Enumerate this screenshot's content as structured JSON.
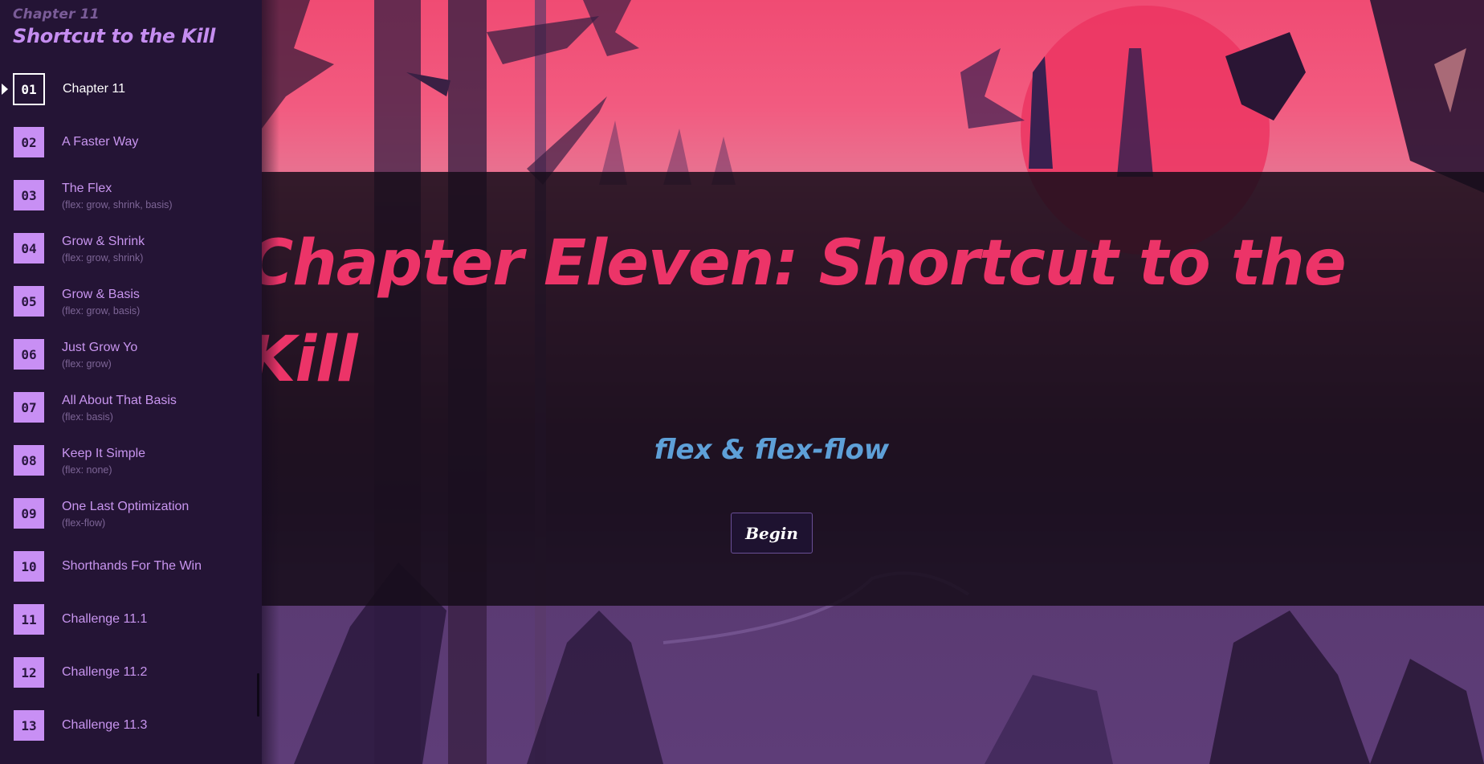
{
  "sidebar": {
    "chapter_kicker": "Chapter 11",
    "chapter_title": "Shortcut to the Kill",
    "active_index": 0,
    "levels": [
      {
        "num": "01",
        "title": "Chapter 11",
        "sub": ""
      },
      {
        "num": "02",
        "title": "A Faster Way",
        "sub": ""
      },
      {
        "num": "03",
        "title": "The Flex",
        "sub": "(flex: grow, shrink, basis)"
      },
      {
        "num": "04",
        "title": "Grow & Shrink",
        "sub": "(flex: grow, shrink)"
      },
      {
        "num": "05",
        "title": "Grow & Basis",
        "sub": "(flex: grow, basis)"
      },
      {
        "num": "06",
        "title": "Just Grow Yo",
        "sub": "(flex: grow)"
      },
      {
        "num": "07",
        "title": "All About That Basis",
        "sub": "(flex: basis)"
      },
      {
        "num": "08",
        "title": "Keep It Simple",
        "sub": "(flex: none)"
      },
      {
        "num": "09",
        "title": "One Last Optimization",
        "sub": "(flex-flow)"
      },
      {
        "num": "10",
        "title": "Shorthands For The Win",
        "sub": ""
      },
      {
        "num": "11",
        "title": "Challenge 11.1",
        "sub": ""
      },
      {
        "num": "12",
        "title": "Challenge 11.2",
        "sub": ""
      },
      {
        "num": "13",
        "title": "Challenge 11.3",
        "sub": ""
      }
    ]
  },
  "main": {
    "heading": "Chapter Eleven: Shortcut to the Kill",
    "topic": "flex & flex-flow",
    "begin_label": "Begin"
  },
  "colors": {
    "sidebar_bg": "#241435",
    "accent_purple": "#c88ff4",
    "heading_pink": "#ec3468",
    "topic_blue": "#5ea0d8",
    "sky_pink": "#f04b73"
  }
}
